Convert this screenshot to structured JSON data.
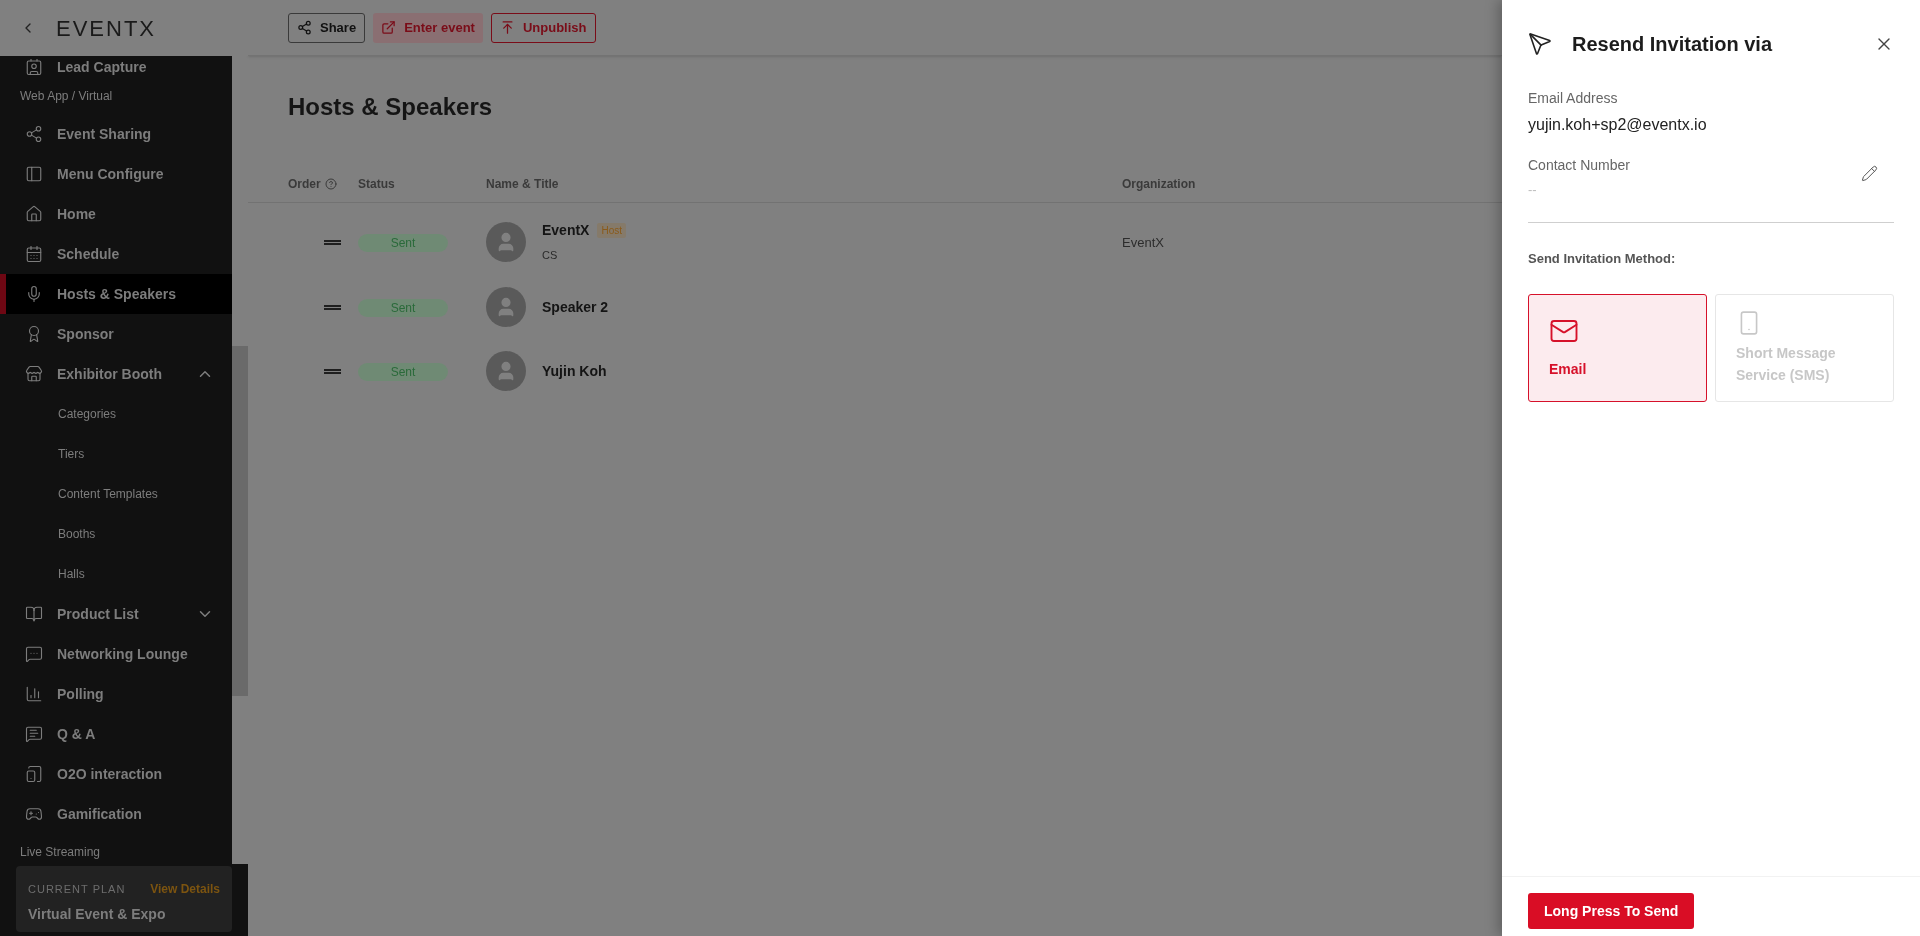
{
  "header": {
    "logo": "EVENTX",
    "actions": [
      {
        "kind": "share",
        "label": "Share"
      },
      {
        "kind": "enter",
        "label": "Enter event"
      },
      {
        "kind": "unpublish",
        "label": "Unpublish"
      }
    ]
  },
  "sidebar": {
    "items": [
      {
        "kind": "item",
        "label": "Lead Capture",
        "selected": false
      },
      {
        "kind": "section",
        "label": "Web App / Virtual"
      },
      {
        "kind": "item",
        "label": "Event Sharing",
        "selected": false
      },
      {
        "kind": "item",
        "label": "Menu Configure",
        "selected": false
      },
      {
        "kind": "item",
        "label": "Home",
        "selected": false
      },
      {
        "kind": "item",
        "label": "Schedule",
        "selected": false
      },
      {
        "kind": "item",
        "label": "Hosts & Speakers",
        "selected": true
      },
      {
        "kind": "item",
        "label": "Sponsor",
        "selected": false
      },
      {
        "kind": "item",
        "label": "Exhibitor Booth",
        "selected": false,
        "expanded": true,
        "children": [
          {
            "label": "Categories"
          },
          {
            "label": "Tiers"
          },
          {
            "label": "Content Templates"
          },
          {
            "label": "Booths"
          },
          {
            "label": "Halls"
          }
        ]
      },
      {
        "kind": "item",
        "label": "Product List",
        "selected": false,
        "expanded": false
      },
      {
        "kind": "item",
        "label": "Networking Lounge",
        "selected": false
      },
      {
        "kind": "item",
        "label": "Polling",
        "selected": false
      },
      {
        "kind": "item",
        "label": "Q & A",
        "selected": false
      },
      {
        "kind": "item",
        "label": "O2O interaction",
        "selected": false
      },
      {
        "kind": "item",
        "label": "Gamification",
        "selected": false
      },
      {
        "kind": "section",
        "label": "Live Streaming"
      }
    ],
    "plan": {
      "caption": "CURRENT PLAN",
      "link": "View Details",
      "name": "Virtual Event & Expo"
    }
  },
  "page": {
    "title": "Hosts & Speakers",
    "table": {
      "columns": [
        "Order",
        "Status",
        "Name & Title",
        "Organization"
      ],
      "rows": [
        {
          "status": "Sent",
          "name": "EventX",
          "badge": "Host",
          "title": "CS",
          "organization": "EventX"
        },
        {
          "status": "Sent",
          "name": "Speaker 2"
        },
        {
          "status": "Sent",
          "name": "Yujin Koh"
        }
      ]
    }
  },
  "drawer": {
    "title": "Resend Invitation via",
    "fields": [
      {
        "label": "Email Address",
        "value": "yujin.koh+sp2@eventx.io",
        "empty": false,
        "editable": false
      },
      {
        "label": "Contact Number",
        "value": "--",
        "empty": true,
        "editable": true
      }
    ],
    "method_label": "Send Invitation Method:",
    "methods": [
      {
        "kind": "email",
        "label": "Email",
        "selected": true,
        "disabled": false
      },
      {
        "kind": "sms",
        "label": "Short Message Service (SMS)",
        "selected": false,
        "disabled": true
      }
    ],
    "submit": "Long Press To Send"
  }
}
